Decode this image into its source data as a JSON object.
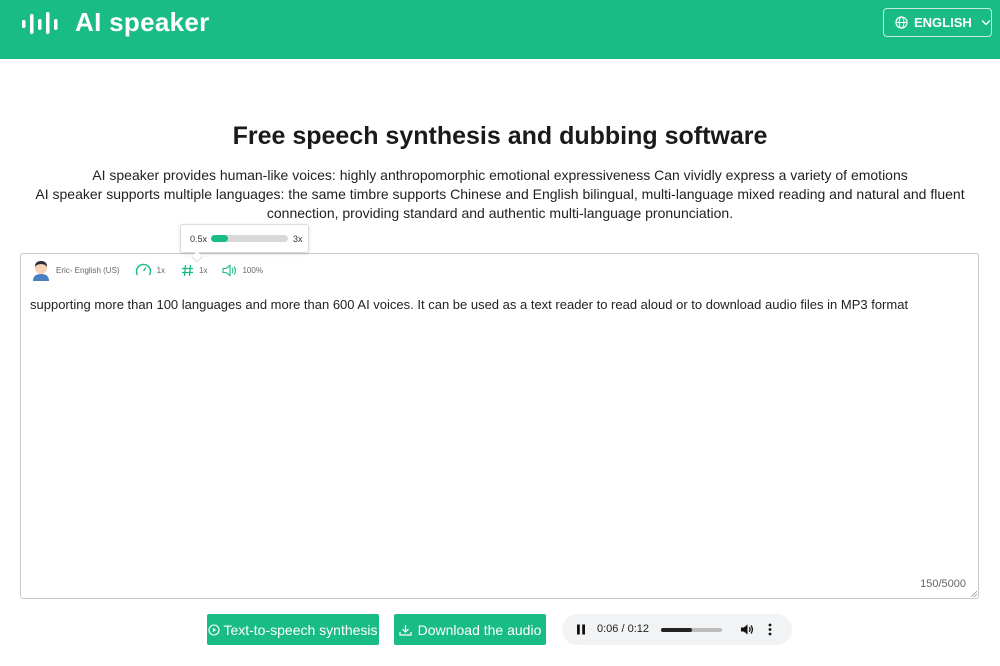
{
  "header": {
    "brand": "AI speaker",
    "language_label": "ENGLISH",
    "icons": {
      "logo": "sound-bars-icon",
      "language": "globe-icon",
      "dropdown": "chevron-down-icon"
    },
    "accent_color": "#1abc85"
  },
  "main": {
    "title": "Free speech synthesis and dubbing software",
    "description_lines": [
      "AI speaker provides human-like voices: highly anthropomorphic emotional expressiveness Can vividly express a variety of emotions",
      "AI speaker supports multiple languages: the same timbre supports Chinese and English bilingual, multi-language mixed reading and natural and fluent connection, providing standard and authentic multi-language pronunciation."
    ]
  },
  "editor": {
    "voice_label": "Eric- English (US)",
    "speed_label": "1x",
    "pitch_label": "1x",
    "volume_label": "100%",
    "text": "supporting more than 100 languages and more than 600 AI voices. It can be used as a text reader to read aloud or to download audio files in MP3 format",
    "char_count": "150/5000",
    "icons": {
      "voice": "avatar-icon",
      "speed": "speedometer-icon",
      "pitch": "hash-icon",
      "volume": "speaker-icon"
    }
  },
  "speed_popup": {
    "min_label": "0.5x",
    "max_label": "3x",
    "level_fraction": 0.22
  },
  "actions": {
    "synthesize_label": "Text-to-speech synthesis",
    "download_label": "Download the audio"
  },
  "player": {
    "time_display": "0:06 / 0:12",
    "progress_fraction": 0.5,
    "icons": {
      "play_state": "pause-icon",
      "volume": "volume-icon",
      "menu": "more-vertical-icon"
    }
  }
}
